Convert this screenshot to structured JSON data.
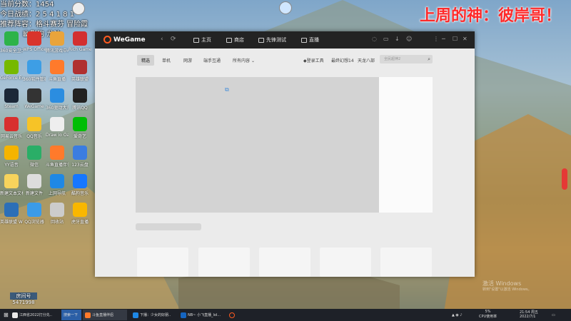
{
  "overlay": {
    "score_line": "当前分数：1454",
    "record_line": "今日战绩：2 5 4 1 8 1",
    "recommend_line": "推荐阵容：格斗赛芬 冒险霞",
    "recommend_line2": "幽影狗 龙法",
    "streamer_title": "上周的神：彼岸哥！",
    "room_label": "房间号",
    "room_number": "5471998"
  },
  "desktop_icons": [
    {
      "label": "360安全卫士",
      "color": "#2db34a"
    },
    {
      "label": "WPS Office",
      "color": "#d9342b"
    },
    {
      "label": "腾讯游戏中心",
      "color": "#e9a43b"
    },
    {
      "label": "Rich Game",
      "color": "#d32f2f"
    },
    {
      "label": "GeForce Experience",
      "color": "#76b900"
    },
    {
      "label": "360软件管家",
      "color": "#3d9ee5"
    },
    {
      "label": "斗鱼直播",
      "color": "#ff7a2b"
    },
    {
      "label": "英雄联盟",
      "color": "#b03030"
    },
    {
      "label": "Steam",
      "color": "#1b2838"
    },
    {
      "label": "WeGame",
      "color": "#333333"
    },
    {
      "label": "360驱动大师",
      "color": "#2b8de0"
    },
    {
      "label": "腾讯QQ",
      "color": "#222222"
    },
    {
      "label": "网易云音乐",
      "color": "#d8302e"
    },
    {
      "label": "QQ音乐",
      "color": "#f6c327"
    },
    {
      "label": "Draw io Oasis",
      "color": "#eeeeee"
    },
    {
      "label": "爱奇艺",
      "color": "#00be06"
    },
    {
      "label": "YY语音",
      "color": "#f5b400"
    },
    {
      "label": "微信",
      "color": "#2aae67"
    },
    {
      "label": "斗鱼直播伴侣",
      "color": "#ff7a2b"
    },
    {
      "label": "123云盘",
      "color": "#3b7de0"
    },
    {
      "label": "新建文本文档",
      "color": "#f7d35c"
    },
    {
      "label": "新建文件",
      "color": "#dddddd"
    },
    {
      "label": "上网导航",
      "color": "#1e88e5"
    },
    {
      "label": "酷狗音乐",
      "color": "#1677ff"
    },
    {
      "label": "英雄联盟 WeGame版",
      "color": "#2c6fb7"
    },
    {
      "label": "QQ浏览器",
      "color": "#3a9be8"
    },
    {
      "label": "回收站",
      "color": "#cccccc"
    },
    {
      "label": "虎牙直播",
      "color": "#f9b700"
    }
  ],
  "window": {
    "app_name": "WeGame",
    "back_icon": "‹",
    "refresh_icon": "⟳",
    "top_nav": [
      "主页",
      "商店",
      "先锋测试",
      "直播"
    ],
    "controls": [
      "⋮",
      "─",
      "☐",
      "✕"
    ],
    "sub_tabs": [
      "精选",
      "单机",
      "网游",
      "端手互通",
      "所有内容"
    ],
    "right_links": [
      "登录工具",
      "最终幻想14",
      "天龙八部"
    ],
    "search_placeholder": "全民超神2"
  },
  "taskbar": {
    "items": [
      "江西省2022打分先..",
      "搜索一下",
      "斗鱼直播伴侣",
      "下播：少女的好朋..",
      "NB~ 小飞直播_lol..."
    ],
    "cpu": "5%",
    "cpu_label": "CPU使用率",
    "time": "21:54 周五",
    "date": "2022/7/1"
  },
  "watermark": {
    "line1": "激活 Windows",
    "line2": "转到\"设置\"以激活 Windows。"
  }
}
